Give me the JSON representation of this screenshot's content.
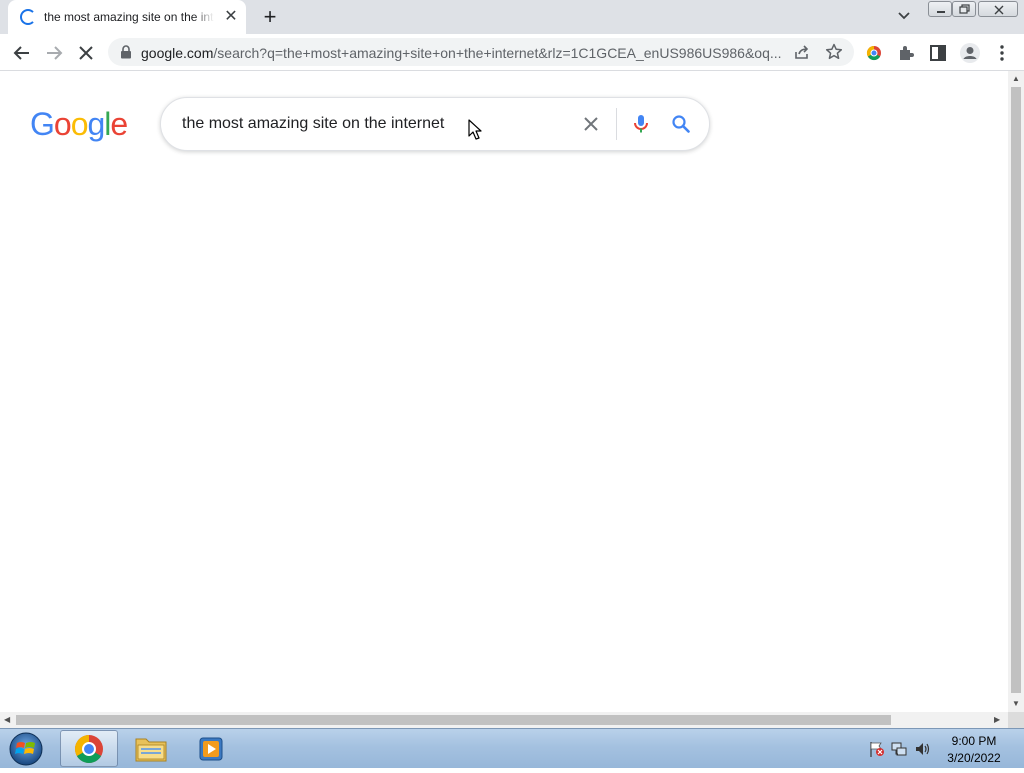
{
  "tab": {
    "title": "the most amazing site on the internet",
    "close_glyph": "✕",
    "new_tab_glyph": "+"
  },
  "toolbar": {
    "url_host": "google.com",
    "url_path": "/search?q=the+most+amazing+site+on+the+internet&rlz=1C1GCEA_enUS986US986&oq..."
  },
  "page": {
    "logo_letters": [
      "G",
      "o",
      "o",
      "g",
      "l",
      "e"
    ],
    "logo_colors": [
      "#4285f4",
      "#ea4335",
      "#fbbc05",
      "#4285f4",
      "#34a853",
      "#ea4335"
    ],
    "search_query": "the most amazing site on the internet"
  },
  "taskbar": {
    "time": "9:00 PM",
    "date": "3/20/2022"
  },
  "colors": {
    "accent": "#1a73e8",
    "tabstrip_bg": "#dee1e6",
    "omnibox_bg": "#f1f3f4"
  }
}
